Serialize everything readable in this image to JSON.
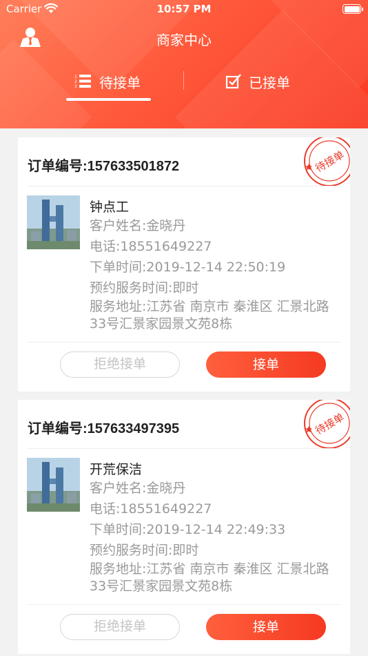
{
  "status_bar": {
    "carrier": "Carrier",
    "time": "10:57 PM"
  },
  "header": {
    "title": "商家中心"
  },
  "tabs": [
    {
      "label": "待接单",
      "icon": "list-numbered-icon",
      "active": true
    },
    {
      "label": "已接单",
      "icon": "checkbox-checked-icon",
      "active": false
    }
  ],
  "orders": [
    {
      "order_no": "订单编号:157633501872",
      "stamp": "待接单",
      "service": "钟点工",
      "customer": "客户姓名:金晓丹",
      "phone": "电话:18551649227",
      "order_time": "下单时间:2019-12-14 22:50:19",
      "service_time": "预约服务时间:即时",
      "address": "服务地址:江苏省 南京市 秦淮区 汇景北路33号汇景家园景文苑8栋",
      "reject_label": "拒绝接单",
      "accept_label": "接单"
    },
    {
      "order_no": "订单编号:157633497395",
      "stamp": "待接单",
      "service": "开荒保洁",
      "customer": "客户姓名:金晓丹",
      "phone": "电话:18551649227",
      "order_time": "下单时间:2019-12-14 22:49:33",
      "service_time": "预约服务时间:即时",
      "address": "服务地址:江苏省 南京市 秦淮区 汇景北路33号汇景家园景文苑8栋",
      "reject_label": "拒绝接单",
      "accept_label": "接单"
    }
  ],
  "colors": {
    "accent": "#f53a22",
    "header_light": "#ff7f5a",
    "text_muted": "#9a9a9a"
  }
}
